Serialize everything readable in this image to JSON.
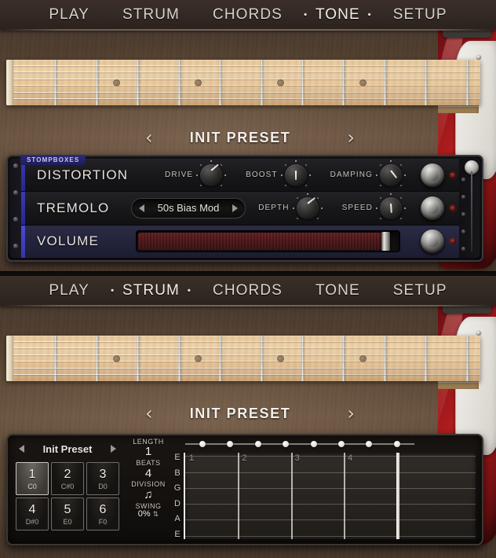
{
  "panels": {
    "top": {
      "nav": {
        "items": [
          {
            "label": "PLAY",
            "active": false
          },
          {
            "label": "STRUM",
            "active": false
          },
          {
            "label": "CHORDS",
            "active": false
          },
          {
            "label": "TONE",
            "active": true
          },
          {
            "label": "SETUP",
            "active": false
          }
        ]
      },
      "preset": {
        "name": "INIT PRESET",
        "prev_icon": "chevron-left-icon",
        "next_icon": "chevron-right-icon"
      },
      "rack": {
        "tab_label": "STOMPBOXES",
        "rows": [
          {
            "name": "DISTORTION",
            "type": "knobs",
            "controls": [
              {
                "label": "DRIVE",
                "angle": -130
              },
              {
                "label": "BOOST",
                "angle": 0
              },
              {
                "label": "DAMPING",
                "angle": -38
              }
            ]
          },
          {
            "name": "TREMOLO",
            "type": "dropdown-knobs",
            "dropdown_value": "50s Bias Mod",
            "controls": [
              {
                "label": "DEPTH",
                "angle": -128
              },
              {
                "label": "SPEED",
                "angle": -4
              }
            ]
          },
          {
            "name": "VOLUME",
            "type": "slider",
            "slider_percent": 95
          }
        ]
      }
    },
    "bottom": {
      "nav": {
        "items": [
          {
            "label": "PLAY",
            "active": false
          },
          {
            "label": "STRUM",
            "active": true
          },
          {
            "label": "CHORDS",
            "active": false
          },
          {
            "label": "TONE",
            "active": false
          },
          {
            "label": "SETUP",
            "active": false
          }
        ]
      },
      "preset": {
        "name": "INIT PRESET",
        "prev_icon": "chevron-left-icon",
        "next_icon": "chevron-right-icon"
      },
      "sequencer": {
        "pattern_select": {
          "value": "Init Preset",
          "prev_icon": "triangle-left-icon",
          "next_icon": "triangle-right-icon"
        },
        "pads": [
          {
            "number": "1",
            "note": "C0",
            "selected": true
          },
          {
            "number": "2",
            "note": "C#0",
            "selected": false
          },
          {
            "number": "3",
            "note": "D0",
            "selected": false
          },
          {
            "number": "4",
            "note": "D#0",
            "selected": false
          },
          {
            "number": "5",
            "note": "E0",
            "selected": false
          },
          {
            "number": "6",
            "note": "F0",
            "selected": false
          }
        ],
        "params": [
          {
            "label": "LENGTH",
            "value": "1",
            "small": false
          },
          {
            "label": "BEATS",
            "value": "4",
            "small": false
          },
          {
            "label": "DIVISION",
            "value": "♫",
            "small": false
          },
          {
            "label": "SWING",
            "value": "0%",
            "small": true,
            "spinner": "⇅"
          }
        ],
        "length_dots": 8,
        "string_labels": [
          "E",
          "B",
          "G",
          "D",
          "A",
          "E"
        ],
        "beat_numbers": [
          "1",
          "2",
          "3",
          "4"
        ]
      }
    }
  },
  "fretboard": {
    "string_count": 6,
    "fret_count": 11,
    "inlay_frets": [
      3,
      5,
      7,
      9
    ]
  },
  "colors": {
    "accent_blue": "#2b2b7a",
    "led_red": "#b03a36",
    "slider_red": "#6d1f21",
    "wood": "#6a5340",
    "guitar_body": "#b01d1d",
    "nav_text": "#d9d2cb"
  }
}
